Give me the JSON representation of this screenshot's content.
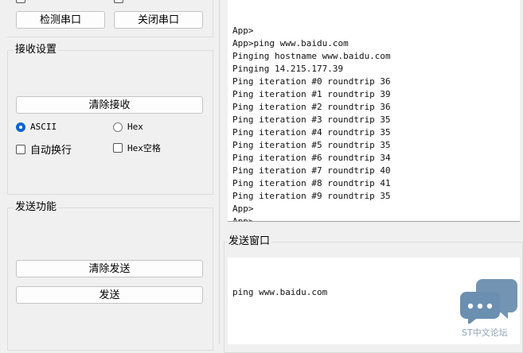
{
  "serial": {
    "detect_label": "检测串口",
    "close_label": "关闭串口"
  },
  "receive": {
    "title": "接收设置",
    "clear_label": "清除接收",
    "ascii_label": "ASCII",
    "hex_label": "Hex",
    "autowrap_label": "自动换行",
    "hex_space_label": "Hex空格",
    "ascii_selected": true
  },
  "send_func": {
    "title": "发送功能",
    "clear_label": "清除发送",
    "send_label": "发送"
  },
  "output": {
    "lines": [
      "App>",
      "App>ping www.baidu.com",
      "Pinging hostname www.baidu.com",
      "Pinging 14.215.177.39",
      "Ping iteration #0 roundtrip 36",
      "Ping iteration #1 roundtrip 39",
      "Ping iteration #2 roundtrip 36",
      "Ping iteration #3 roundtrip 35",
      "Ping iteration #4 roundtrip 35",
      "Ping iteration #5 roundtrip 35",
      "Ping iteration #6 roundtrip 34",
      "Ping iteration #7 roundtrip 40",
      "Ping iteration #8 roundtrip 41",
      "Ping iteration #9 roundtrip 35",
      "App>",
      "App>",
      "App>"
    ]
  },
  "send_window": {
    "title": "发送窗口",
    "content": "ping www.baidu.com"
  },
  "watermark": {
    "text": "ST中文论坛",
    "icon": "chat-bubbles-icon",
    "color": "#5b83a6"
  }
}
